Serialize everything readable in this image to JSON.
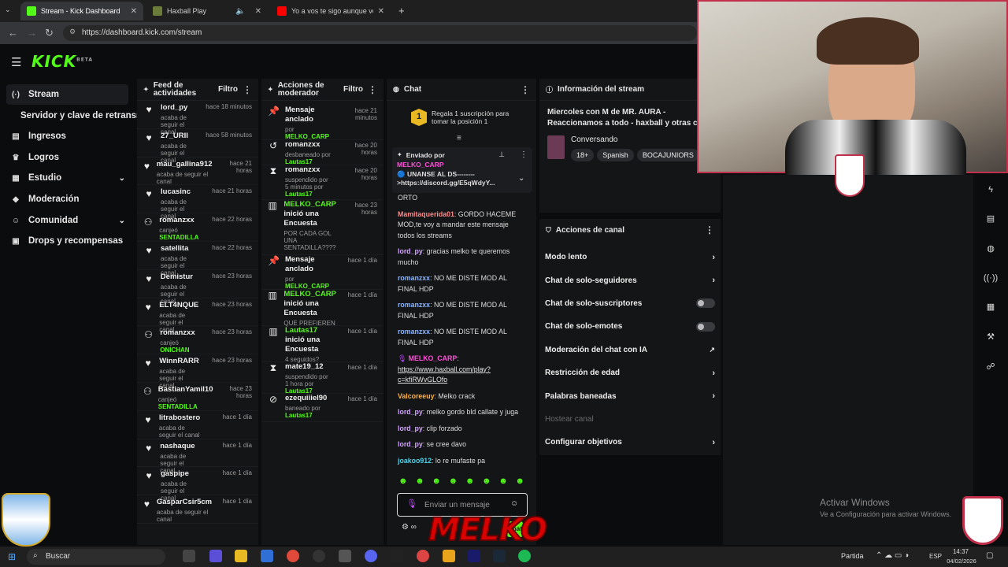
{
  "browser": {
    "tabs": [
      {
        "title": "Stream - Kick Dashboard",
        "color": "#53fc18"
      },
      {
        "title": "Haxball Play",
        "color": "#6b7b3a"
      },
      {
        "title": "Yo a vos te sigo aunque vos vay",
        "color": "#ff0000"
      }
    ],
    "url": "https://dashboard.kick.com/stream"
  },
  "app": {
    "logo": "KICK",
    "beta": "BETA",
    "accent": "#53fc18"
  },
  "sidebar": {
    "items": [
      {
        "label": "Stream",
        "icon": "broadcast-icon",
        "glyph": "(·)",
        "active": true
      },
      {
        "label": "Servidor y clave de retransmisión",
        "icon": "",
        "glyph": ""
      },
      {
        "label": "Ingresos",
        "icon": "money-icon",
        "glyph": "▤"
      },
      {
        "label": "Logros",
        "icon": "trophy-icon",
        "glyph": "♛"
      },
      {
        "label": "Estudio",
        "icon": "studio-icon",
        "glyph": "▦",
        "chevron": true
      },
      {
        "label": "Moderación",
        "icon": "shield-icon",
        "glyph": "◆"
      },
      {
        "label": "Comunidad",
        "icon": "community-icon",
        "glyph": "☺",
        "chevron": true
      },
      {
        "label": "Drops y recompensas",
        "icon": "gift-icon",
        "glyph": "▣"
      }
    ]
  },
  "feed": {
    "title": "Feed de actividades",
    "filter": "Filtro",
    "items": [
      {
        "name": "lord_py",
        "sub": "acaba de seguir el canal",
        "time": "hace 18 minutos",
        "icon": "heart"
      },
      {
        "name": "27_URII",
        "sub": "acaba de seguir el canal",
        "time": "hace 58 minutos",
        "icon": "heart"
      },
      {
        "name": "mau_gallina912",
        "sub": "acaba de seguir el canal",
        "time": "hace 21 horas",
        "icon": "heart"
      },
      {
        "name": "lucasinc",
        "sub": "acaba de seguir el canal",
        "time": "hace 21 horas",
        "icon": "heart"
      },
      {
        "name": "romanzxx",
        "sub": "canjeó",
        "reward": "SENTADILLA",
        "time": "hace 22 horas",
        "icon": "reward"
      },
      {
        "name": "satellita",
        "sub": "acaba de seguir el canal",
        "time": "hace 22 horas",
        "icon": "heart"
      },
      {
        "name": "Demistur",
        "sub": "acaba de seguir el canal",
        "time": "hace 23 horas",
        "icon": "heart"
      },
      {
        "name": "ELT4NQUE",
        "sub": "acaba de seguir el canal",
        "time": "hace 23 horas",
        "icon": "heart"
      },
      {
        "name": "romanzxx",
        "sub": "canjeó",
        "reward": "ONICHAN",
        "time": "hace 23 horas",
        "icon": "reward"
      },
      {
        "name": "WinnRARR",
        "sub": "acaba de seguir el canal",
        "time": "hace 23 horas",
        "icon": "heart"
      },
      {
        "name": "BastianYamil10",
        "sub": "canjeó",
        "reward": "SENTADILLA",
        "time": "hace 23 horas",
        "icon": "reward"
      },
      {
        "name": "litrabostero",
        "sub": "acaba de seguir el canal",
        "time": "hace 1 día",
        "icon": "heart"
      },
      {
        "name": "nashaque",
        "sub": "acaba de seguir el canal",
        "time": "hace 1 día",
        "icon": "heart"
      },
      {
        "name": "gaspipe",
        "sub": "acaba de seguir el canal",
        "time": "hace 1 día",
        "icon": "heart"
      },
      {
        "name": "GasparCsir5cm",
        "sub": "acaba de seguir el canal",
        "time": "hace 1 día",
        "icon": "heart"
      }
    ]
  },
  "mod": {
    "title": "Acciones de moderador",
    "filter": "Filtro",
    "items": [
      {
        "glyph": "📌",
        "name": "Mensaje anclado",
        "sub": "por",
        "by": "MELKO_CARP",
        "time": "hace 21 minutos",
        "h": 44
      },
      {
        "glyph": "↺",
        "name": "romanzxx",
        "sub": "desbaneado por",
        "by": "Lautas17",
        "time": "hace 20 horas",
        "h": 32
      },
      {
        "glyph": "⧗",
        "name": "romanzxx",
        "sub": "suspendido por 5 minutos por",
        "by": "Lautas17",
        "time": "hace 20 horas",
        "h": 44
      },
      {
        "glyph": "▥",
        "name": "MELKO_CARP",
        "name2": "inició una Encuesta",
        "sub": "POR CADA GOL UNA SENTADILLA????",
        "time": "hace 23 horas",
        "h": 70,
        "green": true
      },
      {
        "glyph": "📌",
        "name": "Mensaje anclado",
        "sub": "por",
        "by": "MELKO_CARP",
        "time": "hace 1 día",
        "h": 44
      },
      {
        "glyph": "▥",
        "name": "MELKO_CARP",
        "name2": "inició una Encuesta",
        "sub": "QUE PREFIEREN",
        "time": "hace 1 día",
        "h": 46,
        "green": true
      },
      {
        "glyph": "▥",
        "name": "Lautas17",
        "name2": "inició una Encuesta",
        "sub": "4 seguidos?",
        "time": "hace 1 día",
        "h": 46,
        "green": true
      },
      {
        "glyph": "⧗",
        "name": "mate19_12",
        "sub": "suspendido por 1 hora por",
        "by": "Lautas17",
        "time": "hace 1 día",
        "h": 40
      },
      {
        "glyph": "⊘",
        "name": "ezequiiiel90",
        "sub": "baneado por",
        "by": "Lautas17",
        "time": "hace 1 día",
        "h": 36
      }
    ]
  },
  "chat": {
    "title": "Chat",
    "gift_text": "Regala 1 suscripción para tomar la posición 1",
    "gift_rank": "1",
    "pinned_by_label": "Enviado por",
    "pinned_user": "MELKO_CARP",
    "pinned_msg": "🔵 UNANSE AL DS-------- >https://discord.gg/E5qWdyY...",
    "messages": [
      {
        "user": "",
        "text": "ORTO",
        "color": "#ddd"
      },
      {
        "user": "Mamitaquerida01",
        "text": ": GORDO HACEME MOD,te voy a mandar este mensaje todos los streams",
        "color": "#ff8a8a"
      },
      {
        "user": "lord_py",
        "text": ": gracias melko te queremos mucho",
        "color": "#d4a5ff"
      },
      {
        "user": "romanzxx",
        "text": ": NO ME DISTE MOD AL FINAL HDP",
        "color": "#8ab4ff"
      },
      {
        "user": "romanzxx",
        "text": ": NO ME DISTE MOD AL FINAL HDP",
        "color": "#8ab4ff"
      },
      {
        "user": "romanzxx",
        "text": ": NO ME DISTE MOD AL FINAL HDP",
        "color": "#8ab4ff"
      },
      {
        "user": "MELKO_CARP",
        "text": ":",
        "link": "https://www.haxball.com/play?c=kfiRWvGLOfo",
        "color": "#ff4fd8"
      },
      {
        "user": "Valcoreeuy",
        "text": ": Melko crack",
        "color": "#ffb347"
      },
      {
        "user": "lord_py",
        "text": ": melko gordo bld callate y juga",
        "color": "#d4a5ff"
      },
      {
        "user": "lord_py",
        "text": ": clip forzado",
        "color": "#d4a5ff"
      },
      {
        "user": "lord_py",
        "text": ": se cree davo",
        "color": "#d4a5ff"
      },
      {
        "user": "joakoo912",
        "text": ": lo re mufaste pa",
        "color": "#4fd1e8"
      }
    ],
    "input_placeholder": "Enviar un mensaje",
    "send_label": "Chat"
  },
  "info": {
    "title": "Información del stream",
    "stream_title": "Miercoles con M de MR. AURA - Reaccionamos a todo - haxball y otras cos",
    "category": "Conversando",
    "tags": [
      "18+",
      "Spanish",
      "BOCAJUNIORS"
    ]
  },
  "channel_actions": {
    "title": "Acciones de canal",
    "rows": [
      {
        "label": "Modo lento",
        "type": "chevron"
      },
      {
        "label": "Chat de solo-seguidores",
        "type": "chevron"
      },
      {
        "label": "Chat de solo-suscriptores",
        "type": "toggle"
      },
      {
        "label": "Chat de solo-emotes",
        "type": "toggle"
      },
      {
        "label": "Moderación del chat con IA",
        "type": "external"
      },
      {
        "label": "Restricción de edad",
        "type": "chevron"
      },
      {
        "label": "Palabras baneadas",
        "type": "chevron"
      },
      {
        "label": "Hostear canal",
        "type": "disabled"
      },
      {
        "label": "Configurar objetivos",
        "type": "chevron"
      }
    ]
  },
  "overlay": {
    "activate_title": "Activar Windows",
    "activate_sub": "Ve a Configuración para activar Windows.",
    "melko": "MELKO"
  },
  "taskbar": {
    "search": "Buscar",
    "weather": "Partida",
    "lang": "ESP",
    "time": "14:37",
    "date": "04/02/2026"
  }
}
